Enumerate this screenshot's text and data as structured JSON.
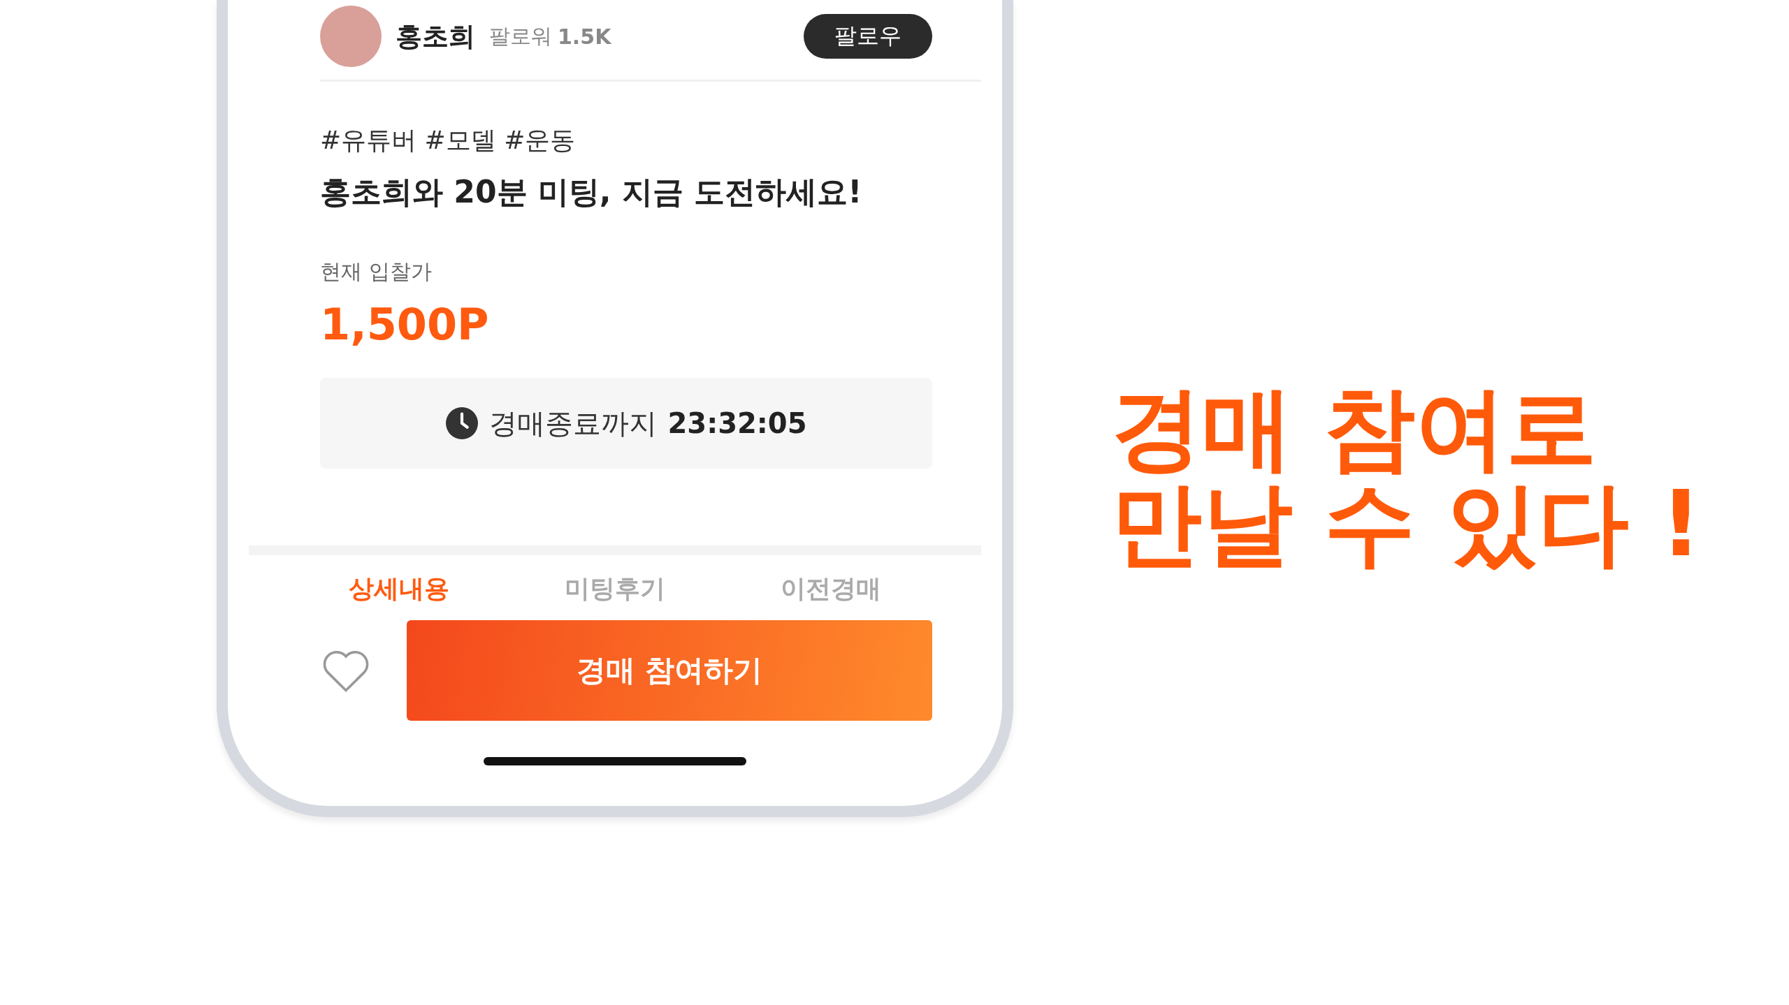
{
  "creator": {
    "name": "홍초희",
    "followers_label": "팔로워",
    "followers": "1.5K",
    "follow_button": "팔로우"
  },
  "tags": "#유튜버 #모델 #운동",
  "title": "홍초희와 20분 미팅, 지금 도전하세요!",
  "bid": {
    "label": "현재 입찰가",
    "price": "1,500P"
  },
  "timer": {
    "label": "경매종료까지",
    "time": "23:32:05"
  },
  "tabs": [
    {
      "label": "상세내용",
      "selected": true
    },
    {
      "label": "미팅후기",
      "selected": false
    },
    {
      "label": "이전경매",
      "selected": false
    }
  ],
  "cta_button": "경매 참여하기",
  "headline": [
    "경매 참여로",
    "만날 수 있다 !"
  ]
}
